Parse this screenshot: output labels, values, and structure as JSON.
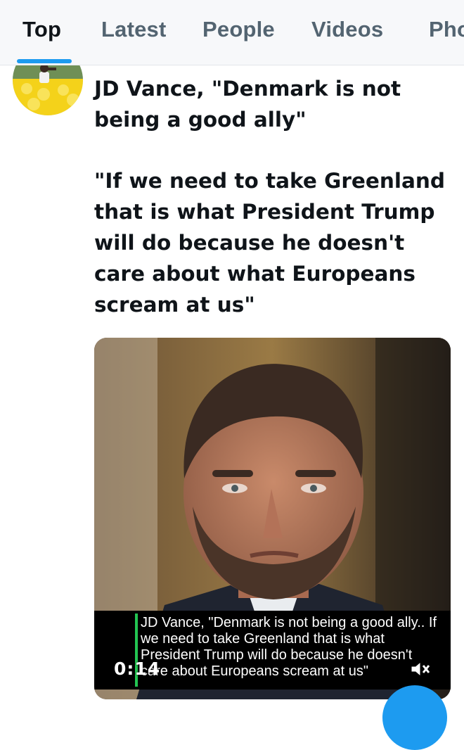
{
  "tabs": [
    {
      "label": "Top",
      "active": true
    },
    {
      "label": "Latest",
      "active": false
    },
    {
      "label": "People",
      "active": false
    },
    {
      "label": "Videos",
      "active": false
    },
    {
      "label": "Photos",
      "active": false
    }
  ],
  "post": {
    "paragraphs": [
      "JD Vance, \"Denmark is not being a good ally\"",
      "\"If we need to take Greenland that is what President Trump will do because he doesn't care about what Europeans scream at us\""
    ],
    "video": {
      "caption": "JD Vance, \"Denmark is not being a good ally.. If we need to take Greenland that is what President Trump will do because he doesn't care about Europeans scream at us\"",
      "timestamp": "0:14",
      "muted": true
    }
  },
  "colors": {
    "accent": "#1d9bf0",
    "text": "#0f1419",
    "muted_text": "#536471",
    "caption_bar": "#23c552"
  },
  "icons": [
    "avatar-image",
    "volume-muted-icon",
    "compose-fab"
  ]
}
